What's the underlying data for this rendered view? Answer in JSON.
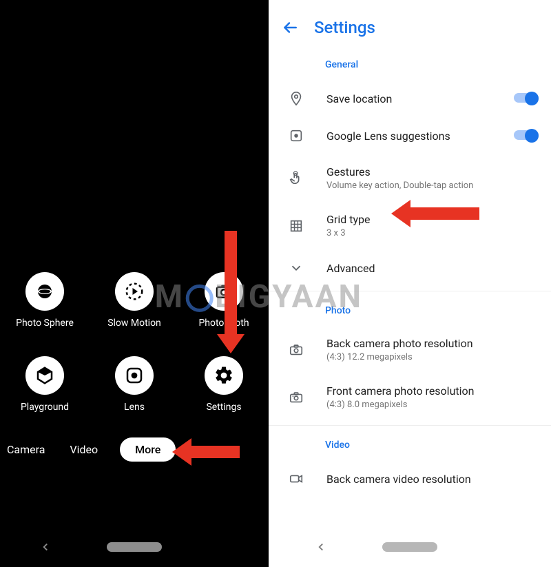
{
  "watermark": {
    "prefix": "M",
    "suffix": "BIGYAAN"
  },
  "camera": {
    "modes": [
      {
        "name": "photo-sphere",
        "label": "Photo Sphere",
        "icon": "sphere-icon"
      },
      {
        "name": "slow-motion",
        "label": "Slow Motion",
        "icon": "slowmo-icon"
      },
      {
        "name": "photobooth",
        "label": "Photobooth",
        "icon": "photobooth-icon"
      },
      {
        "name": "playground",
        "label": "Playground",
        "icon": "playground-icon"
      },
      {
        "name": "lens",
        "label": "Lens",
        "icon": "lens-icon"
      },
      {
        "name": "settings",
        "label": "Settings",
        "icon": "gear-icon"
      }
    ],
    "tabs": {
      "camera": "Camera",
      "video": "Video",
      "more": "More"
    }
  },
  "settings": {
    "title": "Settings",
    "sections": {
      "general": "General",
      "photo": "Photo",
      "video": "Video"
    },
    "items": {
      "save_location": {
        "label": "Save location",
        "on": true
      },
      "lens_suggestions": {
        "label": "Google Lens suggestions",
        "on": true
      },
      "gestures": {
        "label": "Gestures",
        "sub": "Volume key action, Double-tap action"
      },
      "grid_type": {
        "label": "Grid type",
        "sub": "3 x 3"
      },
      "advanced": {
        "label": "Advanced"
      },
      "back_photo": {
        "label": "Back camera photo resolution",
        "sub": "(4:3) 12.2 megapixels"
      },
      "front_photo": {
        "label": "Front camera photo resolution",
        "sub": "(4:3) 8.0 megapixels"
      },
      "back_video": {
        "label": "Back camera video resolution"
      }
    }
  },
  "colors": {
    "accent": "#1a73e8",
    "arrow": "#e73323"
  }
}
